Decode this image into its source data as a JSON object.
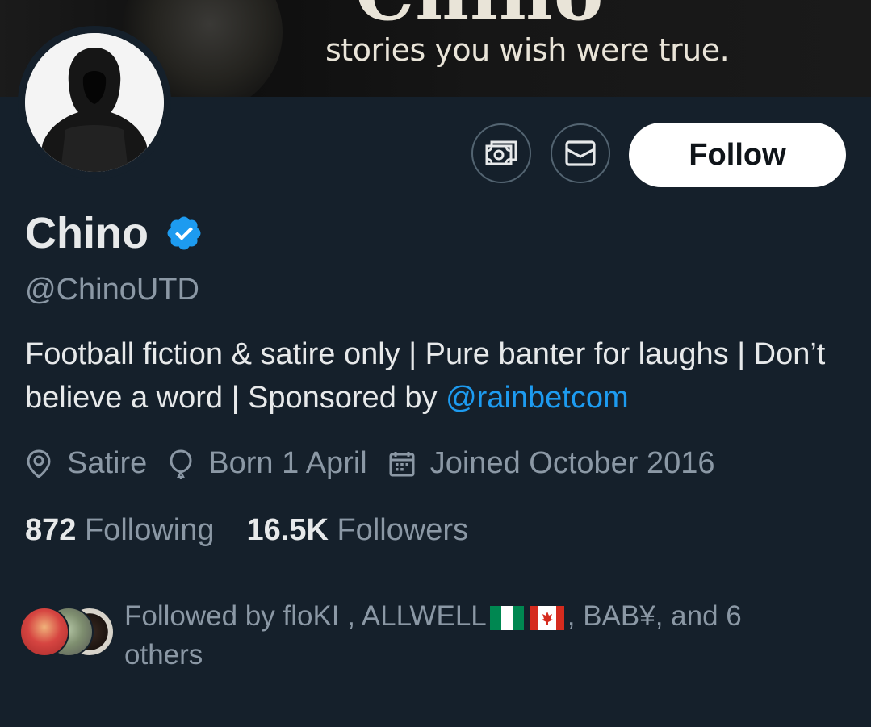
{
  "banner": {
    "title": "Chino",
    "tagline": "stories you wish were true."
  },
  "profile": {
    "display_name": "Chino",
    "verified": true,
    "handle": "@ChinoUTD",
    "bio_text": "Football fiction & satire only | Pure banter for laughs | Don’t believe a word | Sponsored by ",
    "bio_mention": "@rainbetcom",
    "location": "Satire",
    "birthday": "Born 1 April",
    "joined": "Joined October 2016"
  },
  "actions": {
    "tip_icon": "money-icon",
    "message_icon": "envelope-icon",
    "follow_label": "Follow"
  },
  "stats": {
    "following_count": "872",
    "following_label": "Following",
    "followers_count": "16.5K",
    "followers_label": "Followers"
  },
  "followed_by": {
    "prefix": "Followed by floKI   , ALLWELL",
    "flags": [
      "nigeria-flag",
      "canada-flag"
    ],
    "suffix": ", BAB¥, and 6 others"
  },
  "colors": {
    "background": "#15202b",
    "text_primary": "#e7e9ea",
    "text_secondary": "#8b98a5",
    "accent": "#1d9bf0"
  }
}
